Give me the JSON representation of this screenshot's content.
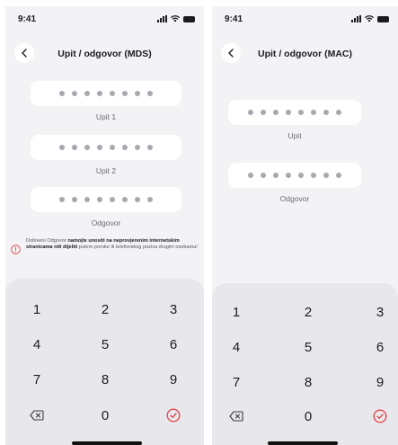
{
  "status_bar": {
    "time": "9:41"
  },
  "left_screen": {
    "title": "Upit / odgovor (MDS)",
    "fields": [
      {
        "label": "Upit 1"
      },
      {
        "label": "Upit 2"
      },
      {
        "label": "Odgovor"
      }
    ],
    "warning": {
      "part1": "Dobiveni Odgovor ",
      "bold1": "namojte unositi na neprovjerenim internetskim stranicama niti dijeliti",
      "part2": " putem poruke ili telefonskog poziva drugim osobama!"
    }
  },
  "right_screen": {
    "title": "Upit / odgovor (MAC)",
    "fields": [
      {
        "label": "Upit"
      },
      {
        "label": "Odgovor"
      }
    ]
  },
  "keypad": {
    "rows": [
      [
        "1",
        "2",
        "3"
      ],
      [
        "4",
        "5",
        "6"
      ],
      [
        "7",
        "8",
        "9"
      ]
    ],
    "zero": "0",
    "delete_icon": "backspace-icon",
    "confirm_icon": "check-circle-icon"
  },
  "colors": {
    "accent": "#e5484d",
    "background": "#f3f3f6",
    "keypad_bg": "#e8e8ec",
    "dot": "#a8a8b0"
  }
}
